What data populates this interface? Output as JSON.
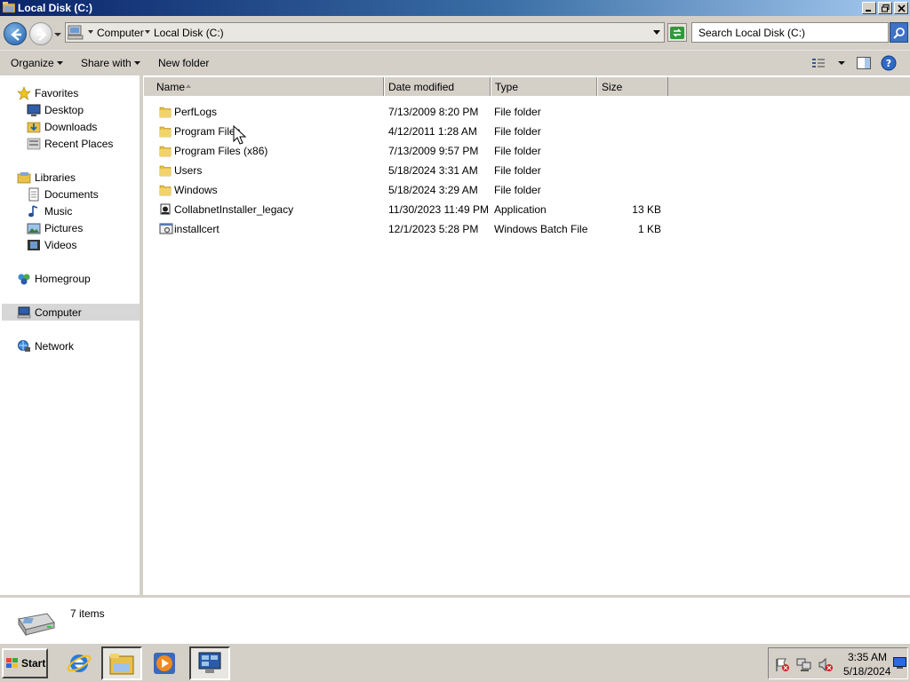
{
  "window": {
    "title": "Local Disk (C:)"
  },
  "address_bar": {
    "breadcrumbs": [
      "Computer",
      "Local Disk (C:)"
    ],
    "search_placeholder": "Search Local Disk (C:)"
  },
  "toolbar": {
    "organize_label": "Organize",
    "share_label": "Share with",
    "new_folder_label": "New folder"
  },
  "sidebar": {
    "favorites": {
      "label": "Favorites",
      "items": [
        "Desktop",
        "Downloads",
        "Recent Places"
      ]
    },
    "libraries": {
      "label": "Libraries",
      "items": [
        "Documents",
        "Music",
        "Pictures",
        "Videos"
      ]
    },
    "homegroup": "Homegroup",
    "computer": "Computer",
    "network": "Network",
    "selected": "Computer"
  },
  "file_list": {
    "columns": [
      "Name",
      "Date modified",
      "Type",
      "Size"
    ],
    "sorted_by": "Name",
    "rows": [
      {
        "name": "PerfLogs",
        "date": "7/13/2009 8:20 PM",
        "type": "File folder",
        "size": "",
        "icon": "folder-icon"
      },
      {
        "name": "Program Files",
        "date": "4/12/2011 1:28 AM",
        "type": "File folder",
        "size": "",
        "icon": "folder-icon"
      },
      {
        "name": "Program Files (x86)",
        "date": "7/13/2009 9:57 PM",
        "type": "File folder",
        "size": "",
        "icon": "folder-icon"
      },
      {
        "name": "Users",
        "date": "5/18/2024 3:31 AM",
        "type": "File folder",
        "size": "",
        "icon": "folder-icon"
      },
      {
        "name": "Windows",
        "date": "5/18/2024 3:29 AM",
        "type": "File folder",
        "size": "",
        "icon": "folder-icon"
      },
      {
        "name": "CollabnetInstaller_legacy",
        "date": "11/30/2023 11:49 PM",
        "type": "Application",
        "size": "13 KB",
        "icon": "application-icon"
      },
      {
        "name": "installcert",
        "date": "12/1/2023 5:28 PM",
        "type": "Windows Batch File",
        "size": "1 KB",
        "icon": "batch-file-icon"
      }
    ]
  },
  "details_pane": {
    "item_count": "7 items"
  },
  "taskbar": {
    "start_label": "Start",
    "clock_time": "3:35 AM",
    "clock_date": "5/18/2024"
  },
  "colors": {
    "titlebar_start": "#0a246a",
    "titlebar_end": "#a6caf0",
    "chrome": "#d4d0c8",
    "folder": "#e8c14a"
  }
}
